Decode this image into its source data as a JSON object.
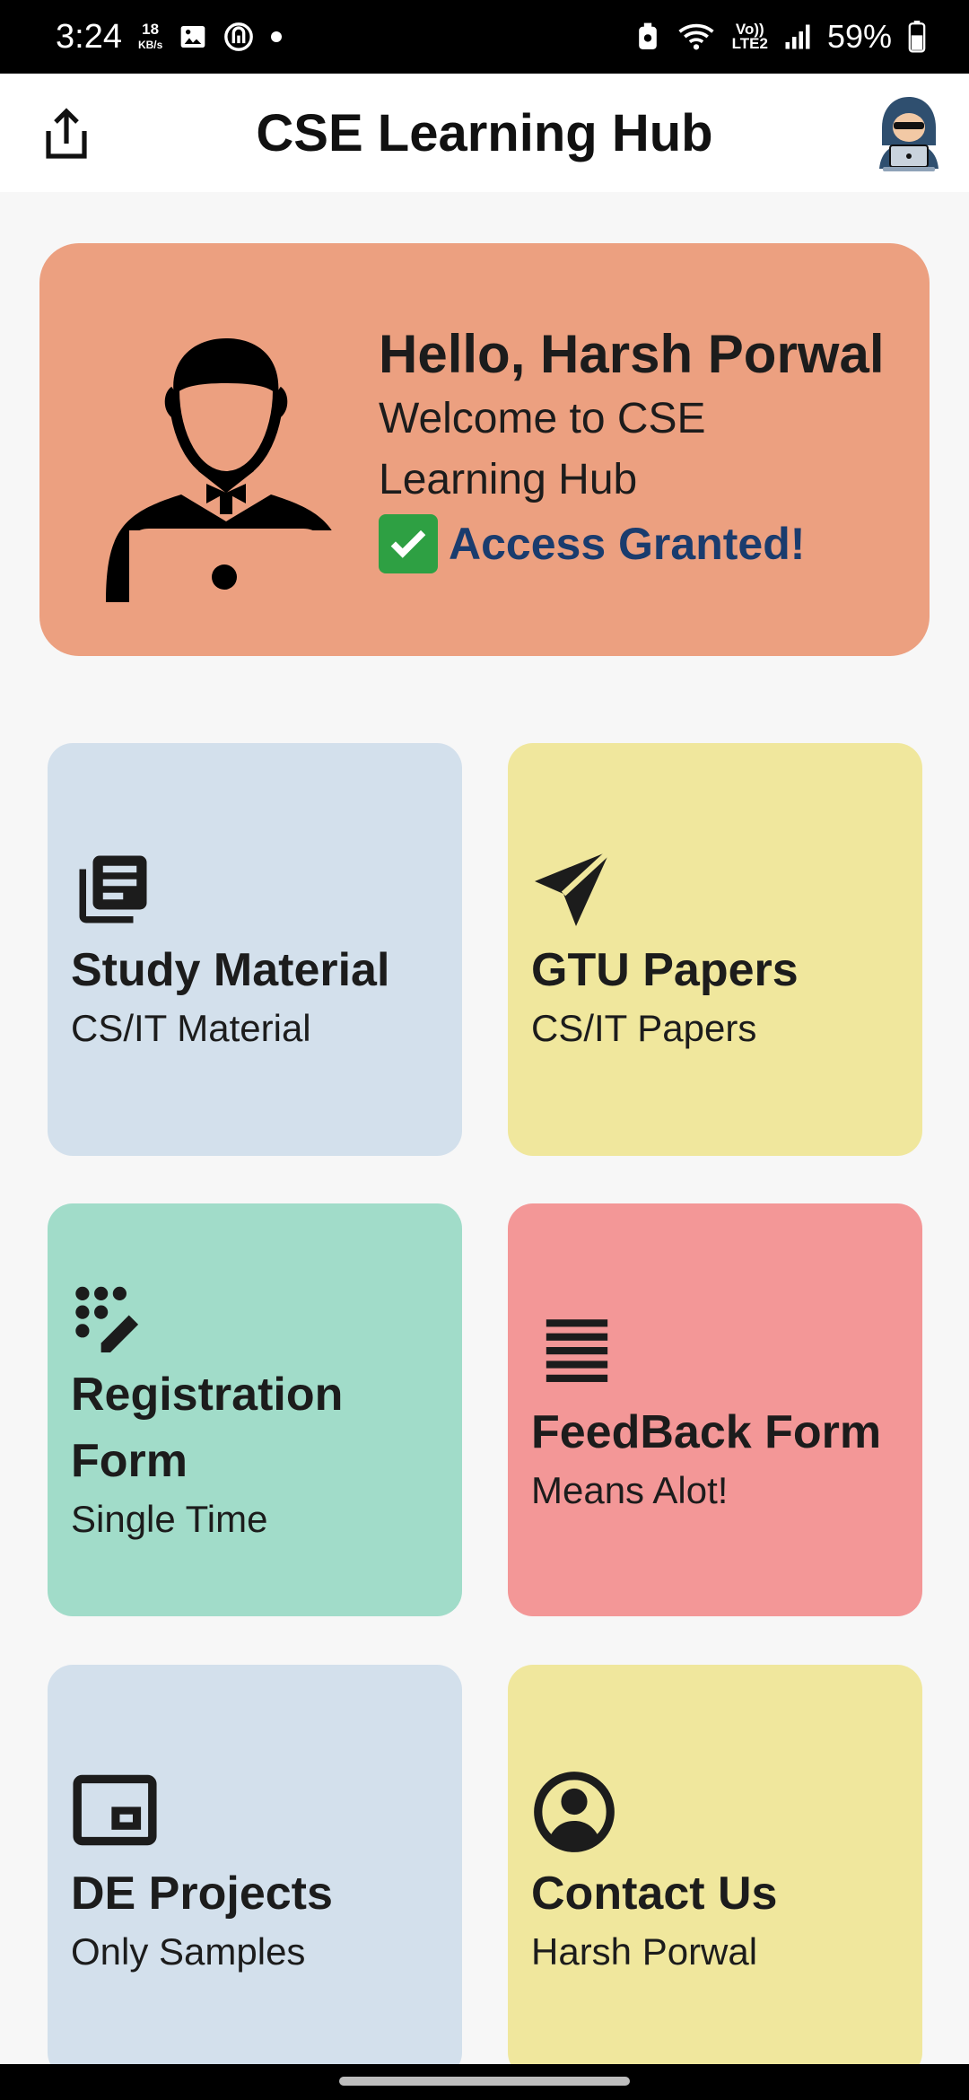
{
  "status_bar": {
    "time": "3:24",
    "net_speed_value": "18",
    "net_speed_unit": "KB/s",
    "network_label_top": "Vo))",
    "network_label_bottom": "LTE2",
    "battery": "59%",
    "icons": [
      "image-icon",
      "app-notification-icon",
      "dot-icon",
      "cleaner-icon",
      "wifi-icon",
      "signal-icon",
      "battery-icon"
    ]
  },
  "app_bar": {
    "title": "CSE Learning Hub",
    "share_icon": "share-icon",
    "avatar_icon": "hacker-avatar-icon"
  },
  "welcome": {
    "greeting": "Hello, Harsh Porwal",
    "message": "Welcome to CSE Learning Hub",
    "access": "Access Granted!",
    "check_icon": "check-mark-icon",
    "background": "#eca080"
  },
  "tiles": [
    {
      "title": "Study Material",
      "subtitle": "CS/IT Material",
      "icon": "library-books-icon",
      "color": "#d3e0ec"
    },
    {
      "title": "GTU Papers",
      "subtitle": "CS/IT Papers",
      "icon": "send-icon",
      "color": "#f0e79d"
    },
    {
      "title": "Registration Form",
      "subtitle": "Single Time",
      "icon": "draw-icon",
      "color": "#a1dcc9"
    },
    {
      "title": "FeedBack Form",
      "subtitle": "Means Alot!",
      "icon": "lines-icon",
      "color": "#f39797"
    },
    {
      "title": "DE Projects",
      "subtitle": "Only Samples",
      "icon": "picture-in-picture-icon",
      "color": "#d3e0ec"
    },
    {
      "title": "Contact Us",
      "subtitle": "Harsh Porwal",
      "icon": "account-circle-icon",
      "color": "#f0e79d"
    }
  ]
}
